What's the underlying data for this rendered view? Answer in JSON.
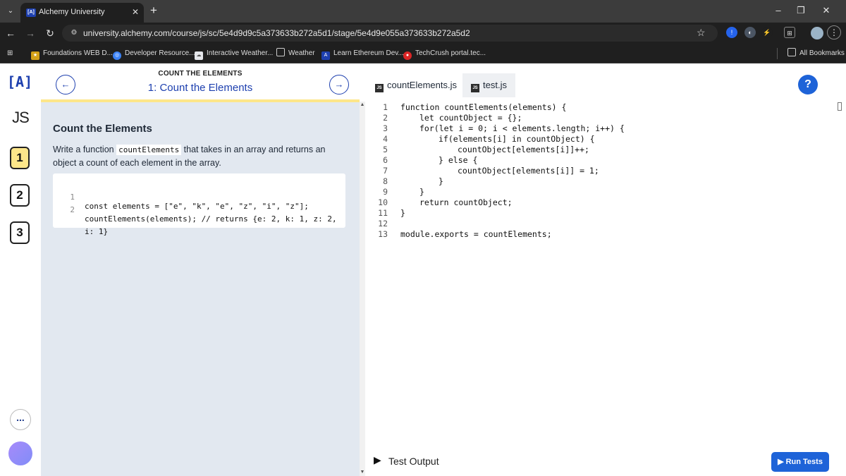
{
  "browser": {
    "tab_title": "Alchemy University",
    "tab_favicon": "[A]",
    "url": "university.alchemy.com/course/js/sc/5e4d9d9c5a373633b272a5d1/stage/5e4d9e055a373633b272a5d2",
    "bookmarks": [
      {
        "label": "Foundations WEB D...",
        "icon": "pin-icon",
        "color": "#d4a017"
      },
      {
        "label": "Developer Resource...",
        "icon": "globe-icon",
        "color": "#3b82f6"
      },
      {
        "label": "Interactive Weather...",
        "icon": "weather-icon",
        "color": "#e5e7eb"
      },
      {
        "label": "Weather",
        "icon": "folder-icon",
        "color": "#1f1f1f"
      },
      {
        "label": "Learn Ethereum Dev...",
        "icon": "alchemy-icon",
        "color": "#1e40af"
      },
      {
        "label": "TechCrush portal.tec...",
        "icon": "techcrush-icon",
        "color": "#dc2626"
      }
    ],
    "all_bookmarks": "All Bookmarks"
  },
  "rail": {
    "logo": "[A]",
    "course": "JS",
    "stages": [
      "1",
      "2",
      "3"
    ],
    "more": "..."
  },
  "lesson": {
    "kicker": "COUNT THE ELEMENTS",
    "title": "1: Count the Elements",
    "heading": "Count the Elements",
    "desc_before": "Write a function ",
    "desc_code": "countElements",
    "desc_after": " that takes in an array and returns an object a count of each element in the array.",
    "example": [
      {
        "n": "1",
        "code": "const elements = [\"e\", \"k\", \"e\", \"z\", \"i\", \"z\"];"
      },
      {
        "n": "2",
        "code": "countElements(elements); // returns {e: 2, k: 1, z: 2,"
      },
      {
        "n": "",
        "code": "i: 1}"
      }
    ]
  },
  "editor": {
    "tabs": [
      "countElements.js",
      "test.js"
    ],
    "help": "?",
    "code": [
      {
        "n": "1",
        "indent": 0,
        "text": "function countElements(elements) {"
      },
      {
        "n": "2",
        "indent": 1,
        "text": "let countObject = {};"
      },
      {
        "n": "3",
        "indent": 1,
        "text": "for(let i = 0; i < elements.length; i++) {"
      },
      {
        "n": "4",
        "indent": 2,
        "text": "if(elements[i] in countObject) {"
      },
      {
        "n": "5",
        "indent": 3,
        "text": "countObject[elements[i]]++;"
      },
      {
        "n": "6",
        "indent": 2,
        "text": "} else {"
      },
      {
        "n": "7",
        "indent": 3,
        "text": "countObject[elements[i]] = 1;"
      },
      {
        "n": "8",
        "indent": 2,
        "text": "}"
      },
      {
        "n": "9",
        "indent": 1,
        "text": "}"
      },
      {
        "n": "10",
        "indent": 1,
        "text": "return countObject;"
      },
      {
        "n": "11",
        "indent": 0,
        "text": "}"
      },
      {
        "n": "12",
        "indent": 0,
        "text": ""
      },
      {
        "n": "13",
        "indent": 0,
        "text": "module.exports = countElements;"
      }
    ],
    "output_label": "Test Output",
    "run_label": "Run Tests"
  },
  "colors": {
    "accent": "#1e40af",
    "run_button": "#1e63d8",
    "lesson_bg": "#e2e8f0",
    "highlight": "#fde68a"
  }
}
